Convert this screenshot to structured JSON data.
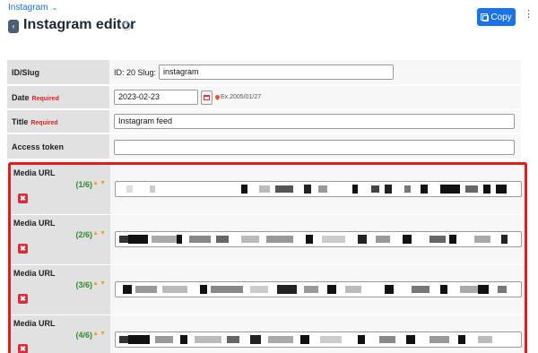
{
  "breadcrumb": {
    "label": "Instagram"
  },
  "header": {
    "title": "Instagram editor",
    "help_glyph": "?",
    "back_glyph": "‹",
    "copy_label": "Copy",
    "more_glyph": "⋮"
  },
  "form": {
    "id_slug": {
      "label": "ID/Slug",
      "id_text": "ID: 20 Slug:",
      "slug_value": "instagram"
    },
    "date": {
      "label": "Date",
      "required": "Required",
      "value": "2023-02-23",
      "example": "Ex.2005/01/27"
    },
    "title": {
      "label": "Title",
      "required": "Required",
      "value": "Instagram feed"
    },
    "access_token": {
      "label": "Access token",
      "value": ""
    }
  },
  "media": {
    "label": "Media URL",
    "delete_glyph": "✖",
    "arrows": "▲▼",
    "items": [
      {
        "counter": "(1/6)"
      },
      {
        "counter": "(2/6)"
      },
      {
        "counter": "(3/6)"
      },
      {
        "counter": "(4/6)"
      }
    ]
  },
  "colors": {
    "accent": "#1a73e8",
    "required": "#d62222",
    "counter": "#2e8b2e",
    "highlight_border": "#e21b1b",
    "delete": "#d92d3a"
  }
}
